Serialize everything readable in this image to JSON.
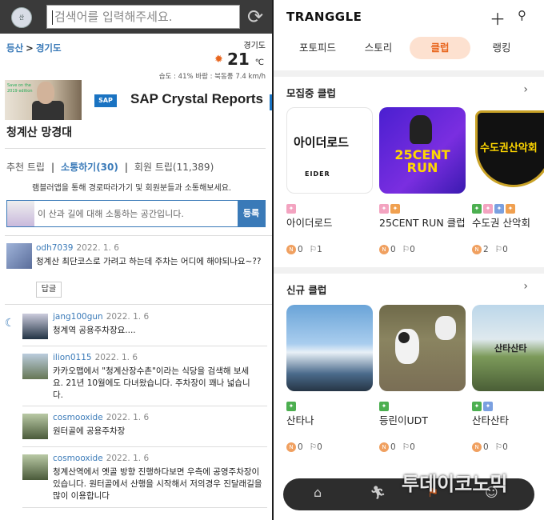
{
  "left": {
    "logo": "산",
    "search_placeholder": "검색어를 입력해주세요.",
    "breadcrumb": [
      "등산",
      "경기도"
    ],
    "weather": {
      "region": "경기도",
      "temp": "21",
      "unit": "℃",
      "detail": "습도 : 41% 바람 : 북동풍 7.4 km/h"
    },
    "ad": {
      "title": "SAP Crystal Reports",
      "badge": "SAP",
      "small_text": "Save on the 2019 edition"
    },
    "mountain_title": "청계산 망경대",
    "tabs": {
      "t1": "추천 트립",
      "t2": "소통하기(30)",
      "t3": "회원 트립(11,389)"
    },
    "help_text": "램블러앱을 통해 경로따라가기 및 회원분들과 소통해보세요.",
    "comment_placeholder": "이 산과 길에 대해 소통하는 공간입니다.",
    "comment_button": "등록",
    "reply_label": "답글",
    "posts": [
      {
        "user": "odh7039",
        "date": "2022. 1. 6",
        "text": "청계산 최단코스로 가려고 하는데 주차는 어디에 해야되나요~??"
      },
      {
        "user": "jang100gun",
        "date": "2022. 1. 6",
        "text": "청계역 공용주차장요...."
      },
      {
        "user": "ilion0115",
        "date": "2022. 1. 6",
        "text": "카카오맵에서 \"청계산장수촌\"이라는 식당을 검색해 보세요. 21년 10월에도 다녀왔습니다. 주차장이 꽤나 넓습니다."
      },
      {
        "user": "cosmooxide",
        "date": "2022. 1. 6",
        "text": "원터골에 공용주차장"
      },
      {
        "user": "cosmooxide",
        "date": "2022. 1. 6",
        "text": "청계산역에서 옛골 방향 진행하다보면 우측에 공영주차장이 있습니다. 원터골에서 산행을 시작해서 저의경우 진달래길을 많이 이용합니다"
      }
    ]
  },
  "right": {
    "logo": "TRANGGLE",
    "tabs": [
      "포토피드",
      "스토리",
      "클럽",
      "랭킹"
    ],
    "section1": "모집중 클럽",
    "section2": "신규 클럽",
    "clubs1": [
      {
        "name": "아이더로드",
        "logo": "아이더로드",
        "sub": "EIDER",
        "n": "0",
        "f": "1"
      },
      {
        "name": "25CENT RUN 클럽",
        "logo": "25CENT RUN",
        "n": "0",
        "f": "0"
      },
      {
        "name": "수도권 산악회",
        "logo": "수도권산악회",
        "n": "2",
        "f": "0"
      }
    ],
    "clubs2": [
      {
        "name": "산타나",
        "n": "0",
        "f": "0"
      },
      {
        "name": "등린이UDT",
        "n": "0",
        "f": "0"
      },
      {
        "name": "산타산타",
        "overlay": "산타산타",
        "n": "0",
        "f": "0"
      }
    ],
    "watermark": "투데이코노믹"
  }
}
